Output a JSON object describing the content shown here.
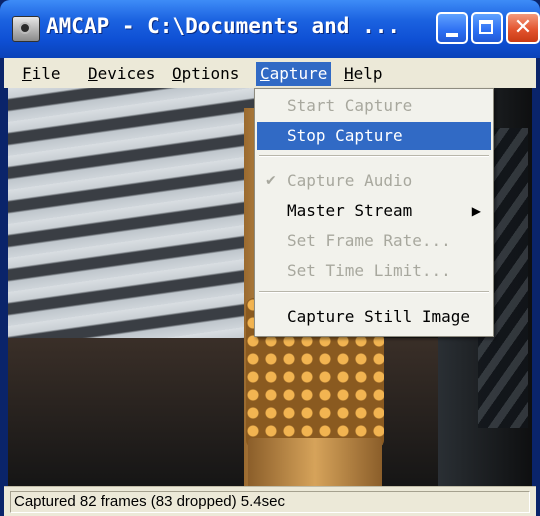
{
  "window": {
    "title": "AMCAP - C:\\Documents and ...",
    "close_glyph": "✕"
  },
  "menubar": {
    "items": [
      {
        "mnemonic": "F",
        "rest": "ile"
      },
      {
        "mnemonic": "D",
        "rest": "evices"
      },
      {
        "mnemonic": "O",
        "rest": "ptions"
      },
      {
        "mnemonic": "C",
        "rest": "apture"
      },
      {
        "mnemonic": "H",
        "rest": "elp"
      }
    ],
    "active": "Capture"
  },
  "capture_menu": {
    "items": [
      {
        "label": "Start Capture",
        "state": "disabled"
      },
      {
        "label": "Stop Capture",
        "state": "highlighted"
      },
      {
        "label": "Capture Audio",
        "state": "disabled",
        "checked": true,
        "check_glyph": "✔"
      },
      {
        "label": "Master Stream",
        "state": "enabled",
        "submenu_glyph": "▶"
      },
      {
        "label": "Set Frame Rate...",
        "state": "disabled"
      },
      {
        "label": "Set Time Limit...",
        "state": "disabled"
      },
      {
        "label": "Capture Still Image",
        "state": "enabled"
      }
    ]
  },
  "statusbar": {
    "text": "Captured 82 frames (83 dropped) 5.4sec"
  },
  "colors": {
    "titlebar": "#0e4fd4",
    "menu_highlight": "#316ac5",
    "menu_background": "#ece9d8",
    "disabled_text": "#a8a89e"
  },
  "icons": [
    "amcap-app-icon",
    "minimize-icon",
    "maximize-icon",
    "close-icon",
    "checkmark-icon",
    "submenu-arrow-icon"
  ]
}
